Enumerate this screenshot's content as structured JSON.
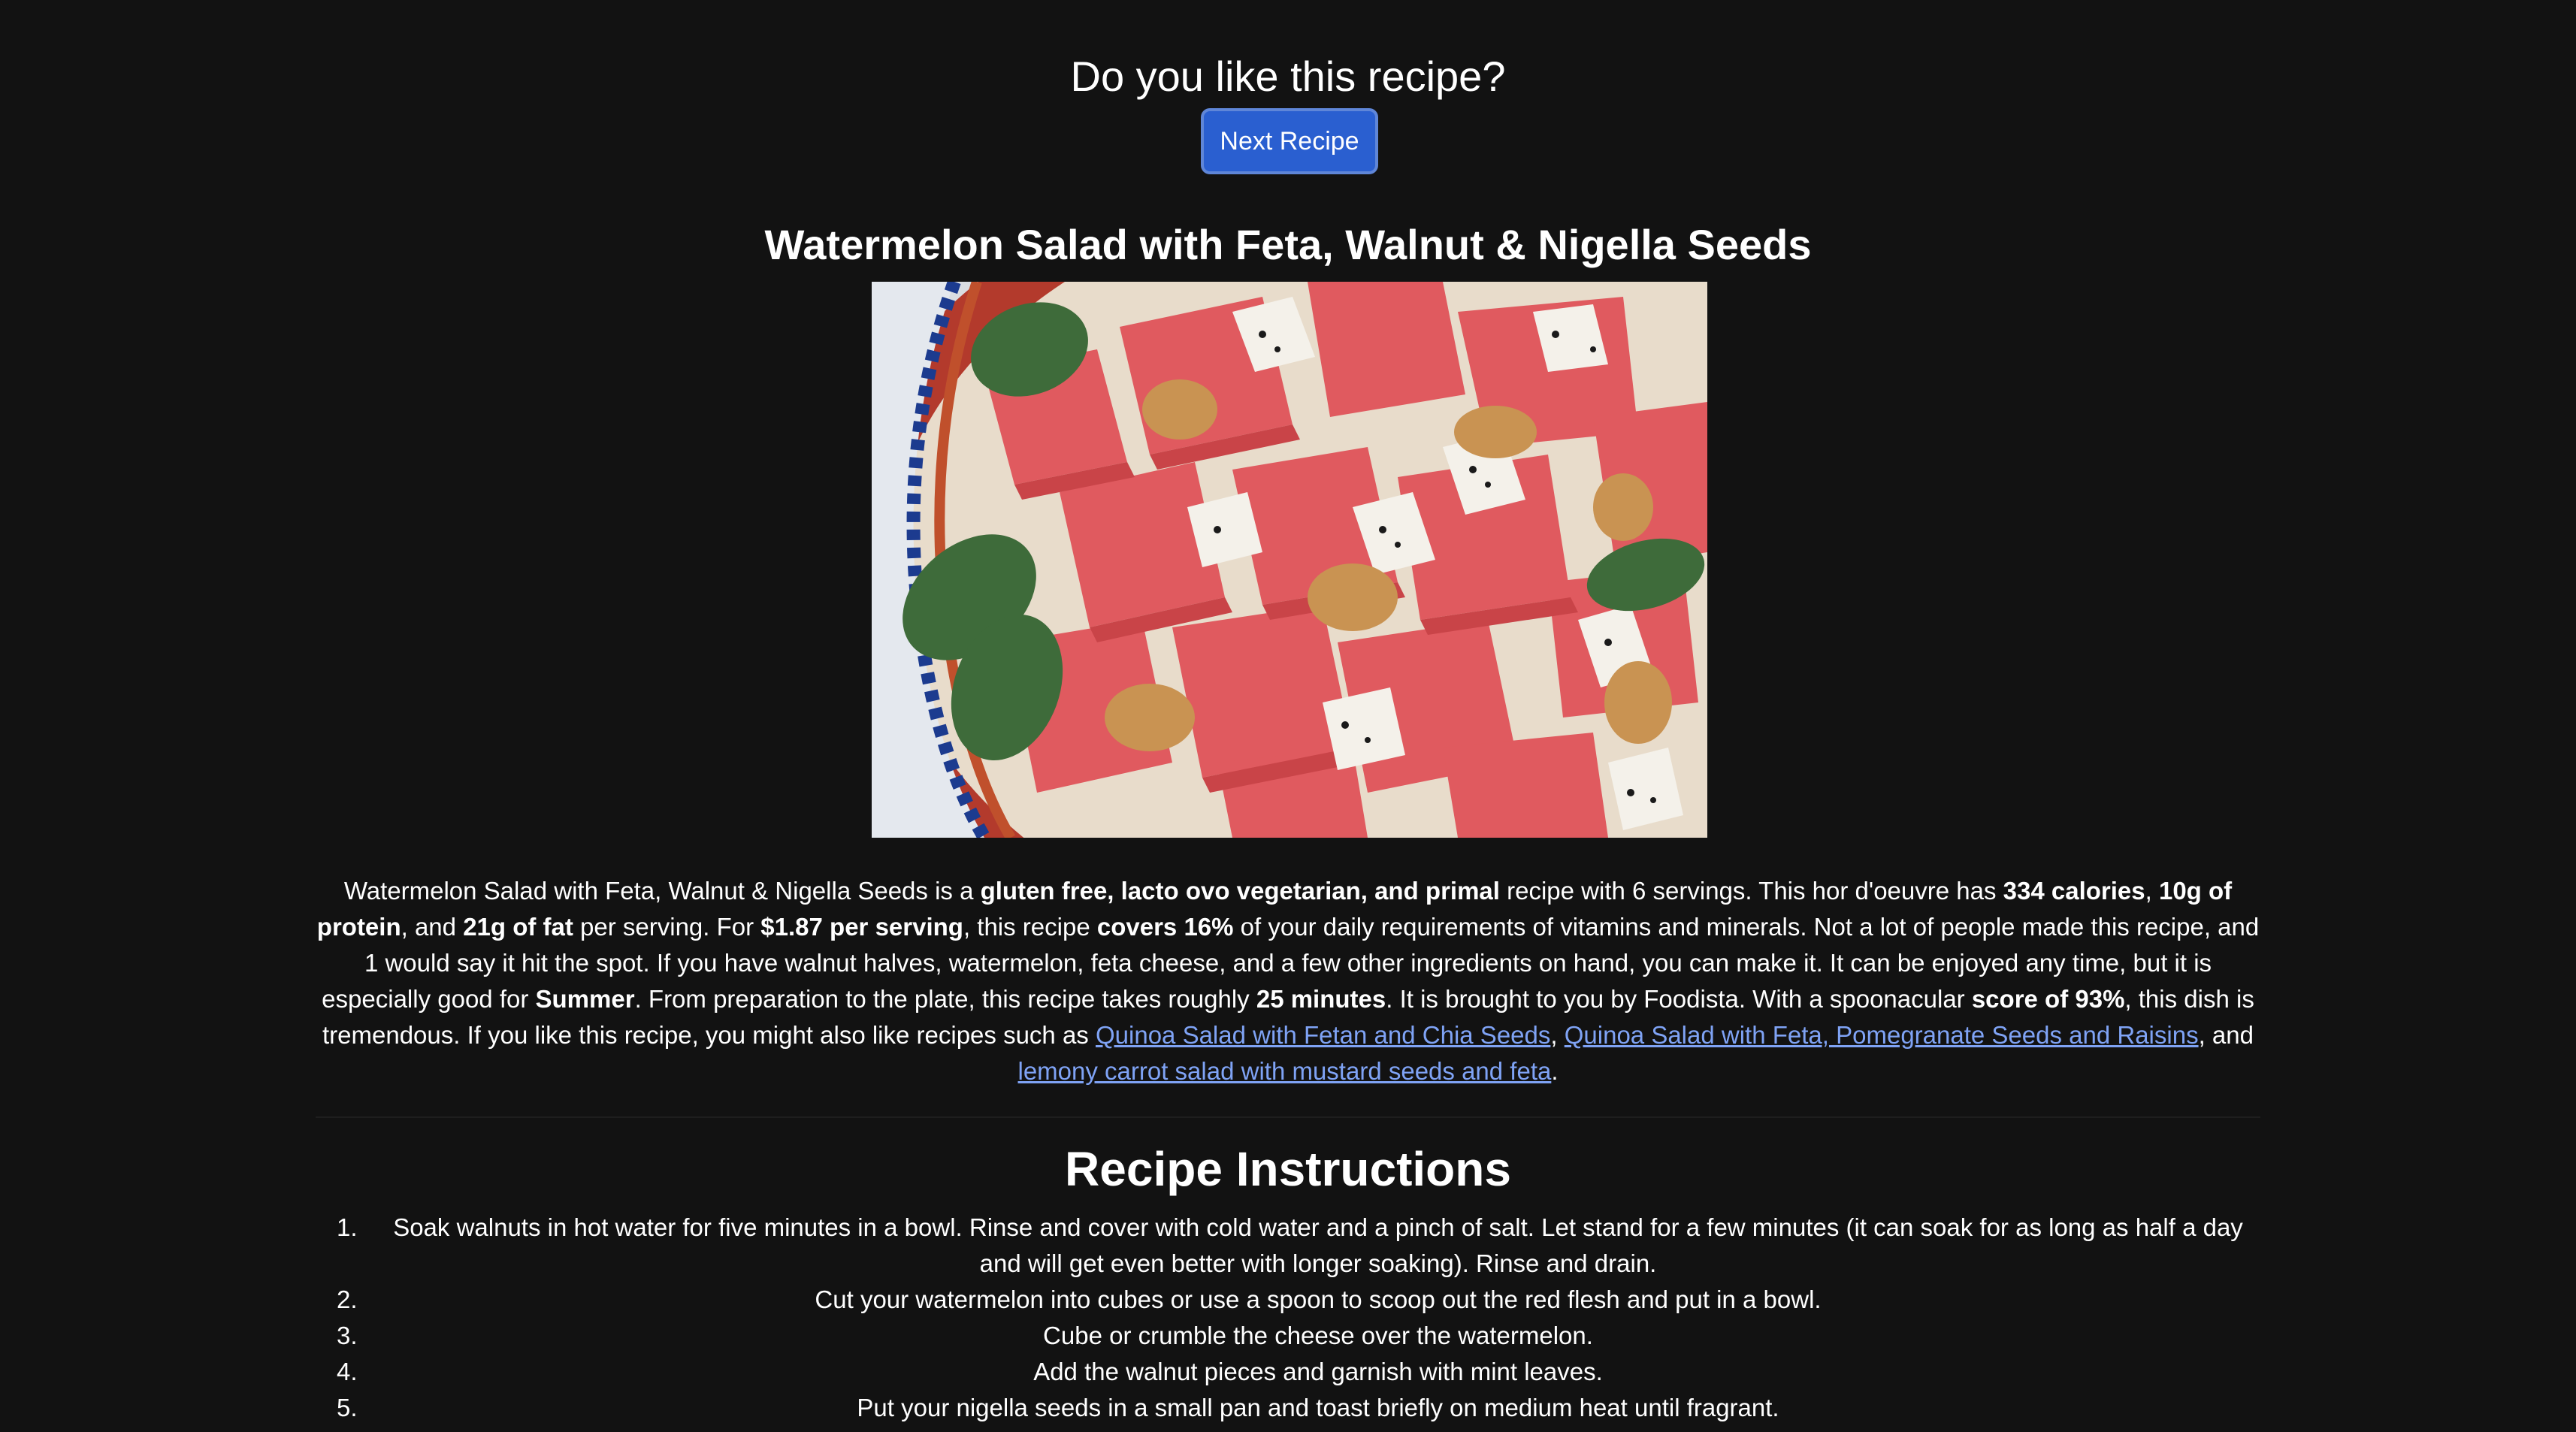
{
  "header": {
    "prompt": "Do you like this recipe?",
    "next_button": "Next Recipe"
  },
  "recipe": {
    "title": "Watermelon Salad with Feta, Walnut & Nigella Seeds",
    "image_alt": "Watermelon Salad with Feta, Walnut & Nigella Seeds",
    "summary": {
      "t1": "Watermelon Salad with Feta, Walnut & Nigella Seeds is a ",
      "b1": "gluten free, lacto ovo vegetarian, and primal",
      "t2": " recipe with 6 servings. This hor d'oeuvre has ",
      "b2": "334 calories",
      "t3": ", ",
      "b3": "10g of protein",
      "t4": ", and ",
      "b4": "21g of fat",
      "t5": " per serving. For ",
      "b5": "$1.87 per serving",
      "t6": ", this recipe ",
      "b6": "covers 16%",
      "t7": " of your daily requirements of vitamins and minerals. Not a lot of people made this recipe, and 1 would say it hit the spot. If you have walnut halves, watermelon, feta cheese, and a few other ingredients on hand, you can make it. It can be enjoyed any time, but it is especially good for ",
      "b7": "Summer",
      "t8": ". From preparation to the plate, this recipe takes roughly ",
      "b8": "25 minutes",
      "t9": ". It is brought to you by Foodista. With a spoonacular ",
      "b9": "score of 93%",
      "t10": ", this dish is tremendous. If you like this recipe, you might also like recipes such as ",
      "link1": "Quinoa Salad with Fetan and Chia Seeds",
      "t11": ", ",
      "link2": "Quinoa Salad with Feta, Pomegranate Seeds and Raisins",
      "t12": ", and ",
      "link3": "lemony carrot salad with mustard seeds and feta",
      "t13": "."
    }
  },
  "instructions": {
    "title": "Recipe Instructions",
    "steps": [
      {
        "num": "1.",
        "text": "Soak walnuts in hot water for five minutes in a bowl. Rinse and cover with cold water and a pinch of salt. Let stand for a few minutes (it can soak for as long as half a day and will get even better with longer soaking). Rinse and drain."
      },
      {
        "num": "2.",
        "text": "Cut your watermelon into cubes or use a spoon to scoop out the red flesh and put in a bowl."
      },
      {
        "num": "3.",
        "text": "Cube or crumble the cheese over the watermelon."
      },
      {
        "num": "4.",
        "text": "Add the walnut pieces and garnish with mint leaves."
      },
      {
        "num": "5.",
        "text": "Put your nigella seeds in a small pan and toast briefly on medium heat until fragrant."
      }
    ]
  },
  "colors": {
    "background": "#121212",
    "button": "#2a5fd0",
    "link": "#7fa3f5"
  }
}
